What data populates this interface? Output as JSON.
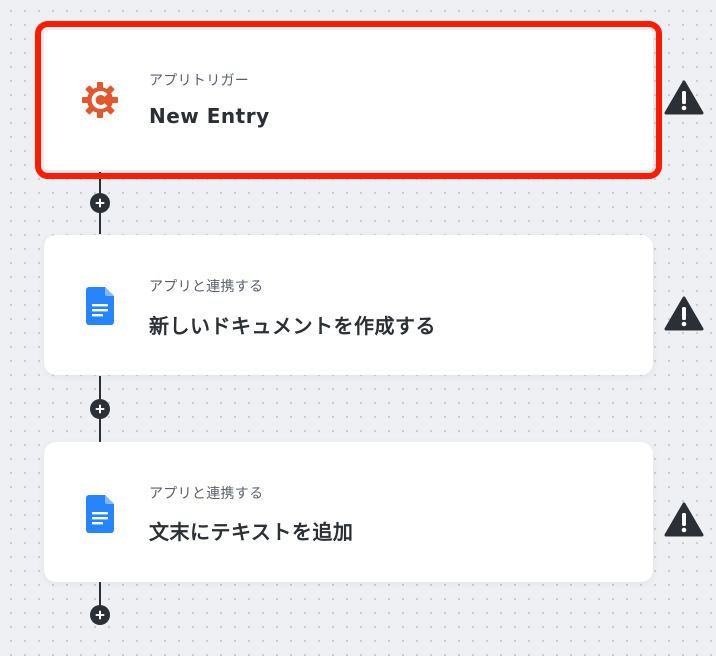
{
  "colors": {
    "background": "#eef0f4",
    "connector": "#2b2f36",
    "selection_outline": "#ff1a00",
    "trigger_icon": "#e2572b",
    "docs_icon": "#2684fc",
    "warning": "#2b2f36"
  },
  "flow": {
    "steps": [
      {
        "icon": "gear-c-icon",
        "subtitle": "アプリトリガー",
        "title": "New Entry",
        "selected": true,
        "warning_icon": "warning-icon"
      },
      {
        "icon": "google-docs-icon",
        "subtitle": "アプリと連携する",
        "title": "新しいドキュメントを作成する",
        "selected": false,
        "warning_icon": "warning-icon"
      },
      {
        "icon": "google-docs-icon",
        "subtitle": "アプリと連携する",
        "title": "文末にテキストを追加",
        "selected": false,
        "warning_icon": "warning-icon"
      }
    ],
    "add_step_icon": "plus-icon"
  }
}
